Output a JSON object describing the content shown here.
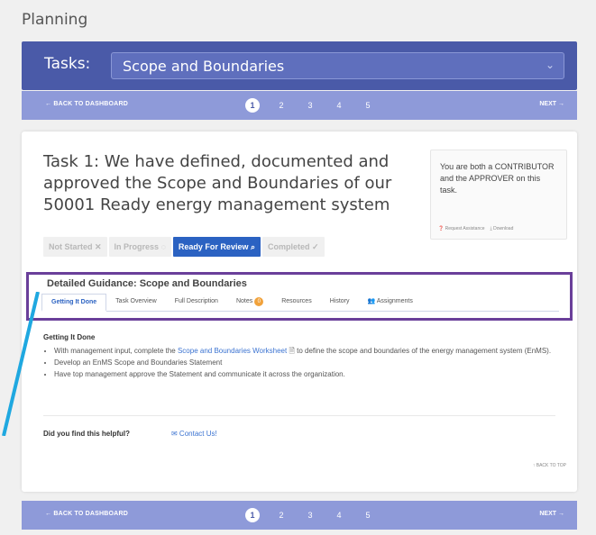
{
  "page_title": "Planning",
  "task_header": {
    "label": "Tasks:",
    "selected_task": "Scope and Boundaries"
  },
  "nav": {
    "back_label": "← BACK TO DASHBOARD",
    "next_label": "NEXT →",
    "pages": [
      "1",
      "2",
      "3",
      "4",
      "5"
    ],
    "active_page": "1"
  },
  "task": {
    "title": "Task 1: We have defined, documented and approved the Scope and Boundaries of our 50001 Ready energy management system"
  },
  "role_box": {
    "text": "You are both a CONTRIBUTOR and the APPROVER on this task.",
    "request_assistance": "❓ Request Assistance",
    "download": "⤓ Download"
  },
  "statuses": [
    {
      "label": "Not Started ✕",
      "active": false
    },
    {
      "label": "In Progress ◌",
      "active": false
    },
    {
      "label": "Ready For Review ⌕",
      "active": true
    },
    {
      "label": "Completed ✓",
      "active": false
    }
  ],
  "guidance": {
    "title": "Detailed Guidance: Scope and Boundaries",
    "tabs": [
      "Getting It Done",
      "Task Overview",
      "Full Description",
      "Notes",
      "Resources",
      "History",
      "Assignments"
    ],
    "notes_count": "0",
    "active_tab": "Getting It Done"
  },
  "content": {
    "heading": "Getting It Done",
    "bullet1_pre": "With management input, complete the ",
    "bullet1_link": "Scope and Boundaries Worksheet",
    "bullet1_post": " to define the scope and boundaries of the energy management system (EnMS).",
    "bullet2": "Develop an EnMS Scope and Boundaries Statement",
    "bullet3": "Have top management approve the Statement and communicate it across the organization."
  },
  "helpful": {
    "question": "Did you find this helpful?",
    "contact": "✉ Contact Us!"
  },
  "back_to_top": "↑ BACK TO TOP",
  "colors": {
    "header": "#4a5aa8",
    "nav": "#8e9ad9",
    "accent": "#2b62c2",
    "highlight_border": "#6a3f9a",
    "arrow": "#1fa8e0"
  }
}
